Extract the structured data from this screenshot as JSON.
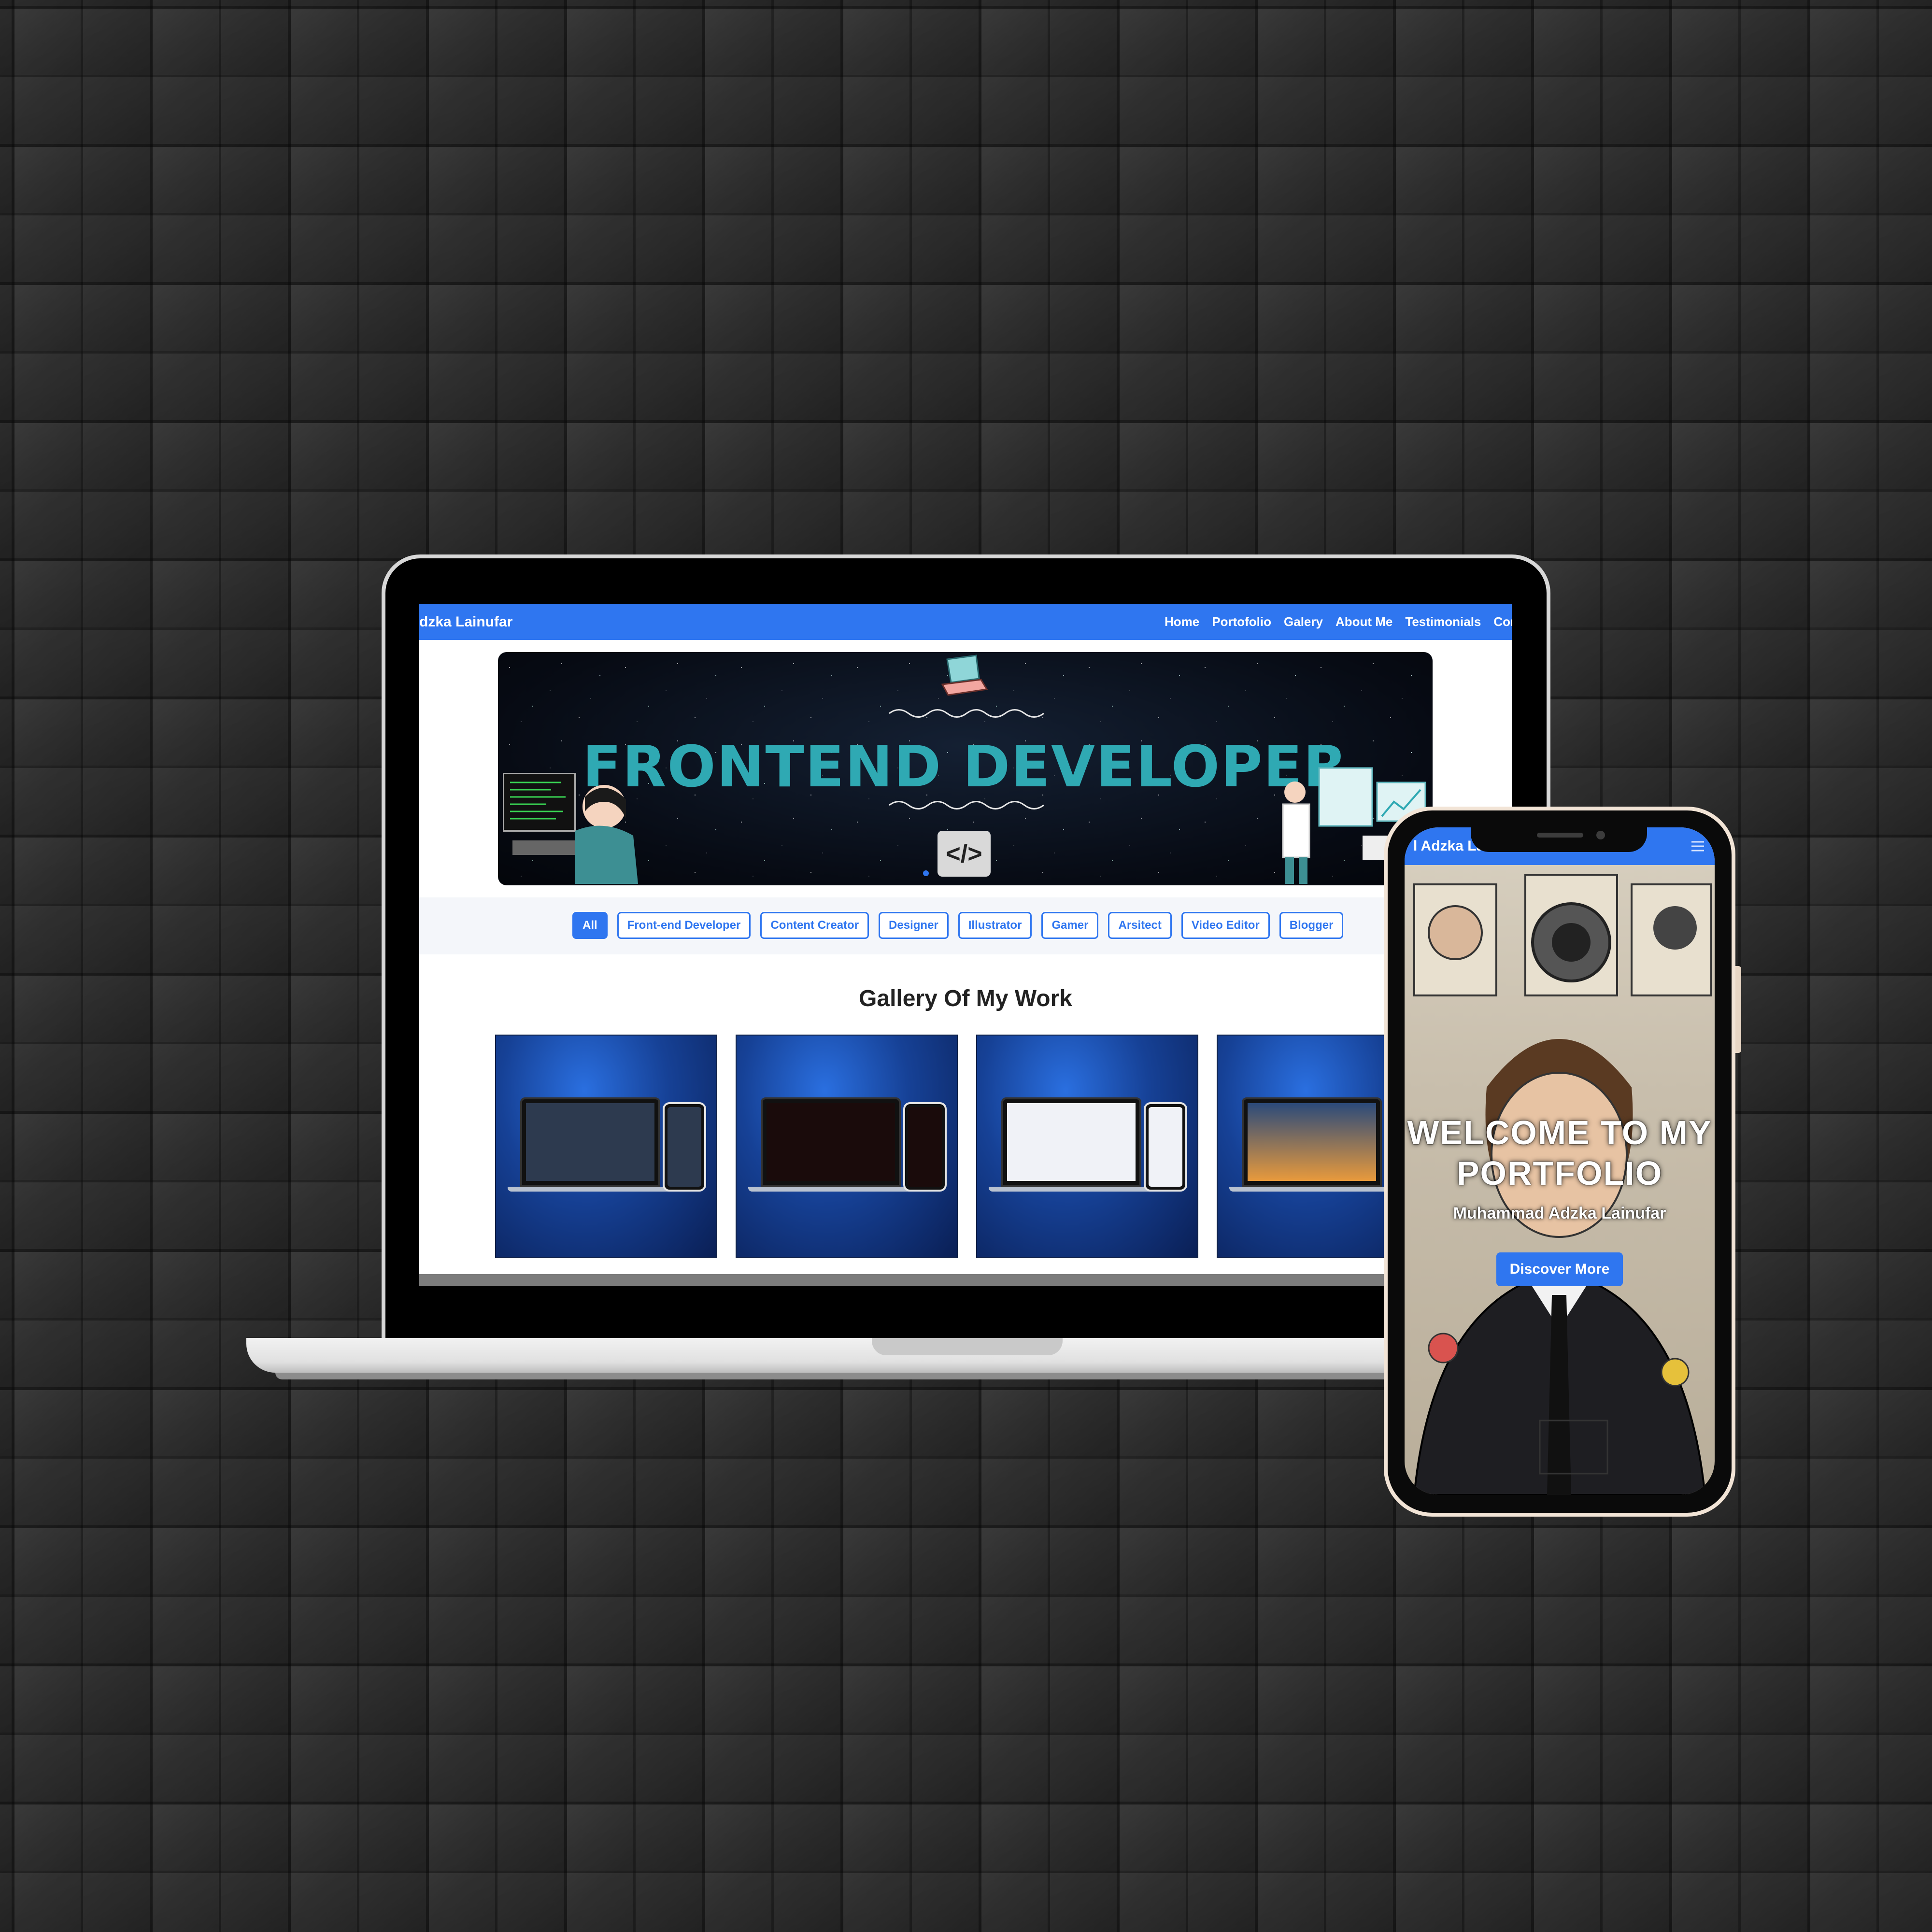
{
  "laptop": {
    "nav": {
      "brand": "dzka Lainufar",
      "links": [
        "Home",
        "Portofolio",
        "Galery",
        "About Me",
        "Testimonials",
        "Con"
      ]
    },
    "hero": {
      "title": "FRONTEND DEVELOPER",
      "code_icon": "</>"
    },
    "filters": [
      "All",
      "Front-end Developer",
      "Content Creator",
      "Designer",
      "Illustrator",
      "Gamer",
      "Arsitect",
      "Video Editor",
      "Blogger"
    ],
    "active_filter": "All",
    "gallery": {
      "title": "Gallery Of My Work",
      "cards": [
        {
          "name": "portfolio-dark-grey",
          "accent": "#2d3a4f"
        },
        {
          "name": "portfolio-red-black",
          "accent": "#1a0b0b"
        },
        {
          "name": "portfolio-white-blue",
          "accent": "#f0f2f7"
        },
        {
          "name": "portfolio-sunset-calculator",
          "accent": "#2b4a7a"
        }
      ]
    }
  },
  "phone": {
    "brand": "l Adzka La",
    "menu_icon": "hamburger-menu-icon",
    "welcome": "WELCOME TO MY PORTFOLIO",
    "name": "Muhammad Adzka Lainufar",
    "cta": "Discover More"
  },
  "colors": {
    "accent": "#2f76f0",
    "hero_title": "#2fa9b3",
    "background": "#2a2a2a"
  }
}
